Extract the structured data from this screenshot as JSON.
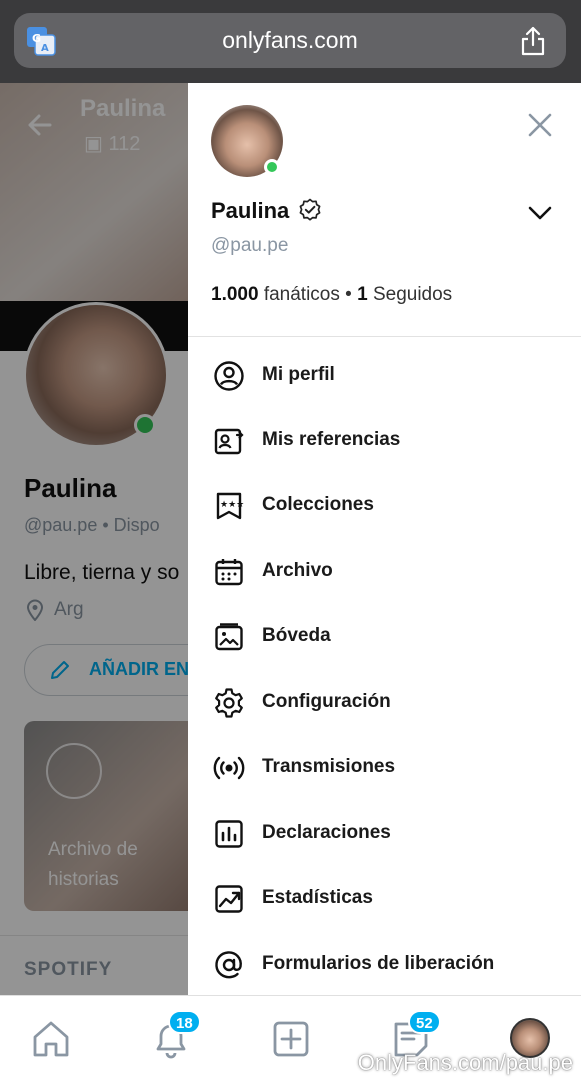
{
  "browser": {
    "url": "onlyfans.com",
    "icons": {
      "left": "translate-icon",
      "right": "share-icon"
    }
  },
  "background_profile": {
    "name_top": "Paulina",
    "media_count": "112",
    "name": "Paulina",
    "handle": "@pau.pe",
    "handle_suffix": "Dispo",
    "bio": "Libre, tierna y so",
    "location": "Arg",
    "add_button_label": "AÑADIR EN",
    "story_label": "Archivo de historias",
    "spotify_label": "SPOTIFY"
  },
  "drawer": {
    "name": "Paulina",
    "handle": "@pau.pe",
    "fans_count": "1.000",
    "fans_label": "fanáticos",
    "following_count": "1",
    "following_label": "Seguidos",
    "menu": [
      {
        "label": "Mi perfil",
        "icon": "profile-icon"
      },
      {
        "label": "Mis referencias",
        "icon": "referrals-icon"
      },
      {
        "label": "Colecciones",
        "icon": "collections-icon"
      },
      {
        "label": "Archivo",
        "icon": "calendar-icon"
      },
      {
        "label": "Bóveda",
        "icon": "vault-icon"
      },
      {
        "label": "Configuración",
        "icon": "gear-icon"
      },
      {
        "label": "Transmisiones",
        "icon": "broadcast-icon"
      },
      {
        "label": "Declaraciones",
        "icon": "statements-icon"
      },
      {
        "label": "Estadísticas",
        "icon": "statistics-icon"
      },
      {
        "label": "Formularios de liberación",
        "icon": "at-icon"
      }
    ]
  },
  "bottom_nav": {
    "notifications_badge": "18",
    "messages_badge": "52",
    "accent": "#00aff0"
  },
  "watermark": "OnlyFans.com/pau.pe"
}
